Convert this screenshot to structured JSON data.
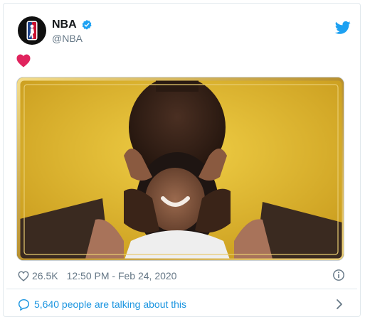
{
  "tweet": {
    "author": {
      "display_name": "NBA",
      "handle": "@NBA",
      "verified": true,
      "avatar_icon": "nba-logo-icon"
    },
    "body_emoji": "red-heart-icon",
    "photo": {
      "subject": "father-kissing-child-photo"
    },
    "likes": "26.5K",
    "timestamp": "12:50 PM - Feb 24, 2020",
    "conversation_link": "5,640 people are talking about this"
  },
  "colors": {
    "twitter_blue": "#1da1f2",
    "link_blue": "#1b95e0",
    "heart_red": "#e0245e",
    "meta_gray": "#657786",
    "gold_frame": "#c9a64a",
    "shirt_yellow": "#e8c233"
  }
}
